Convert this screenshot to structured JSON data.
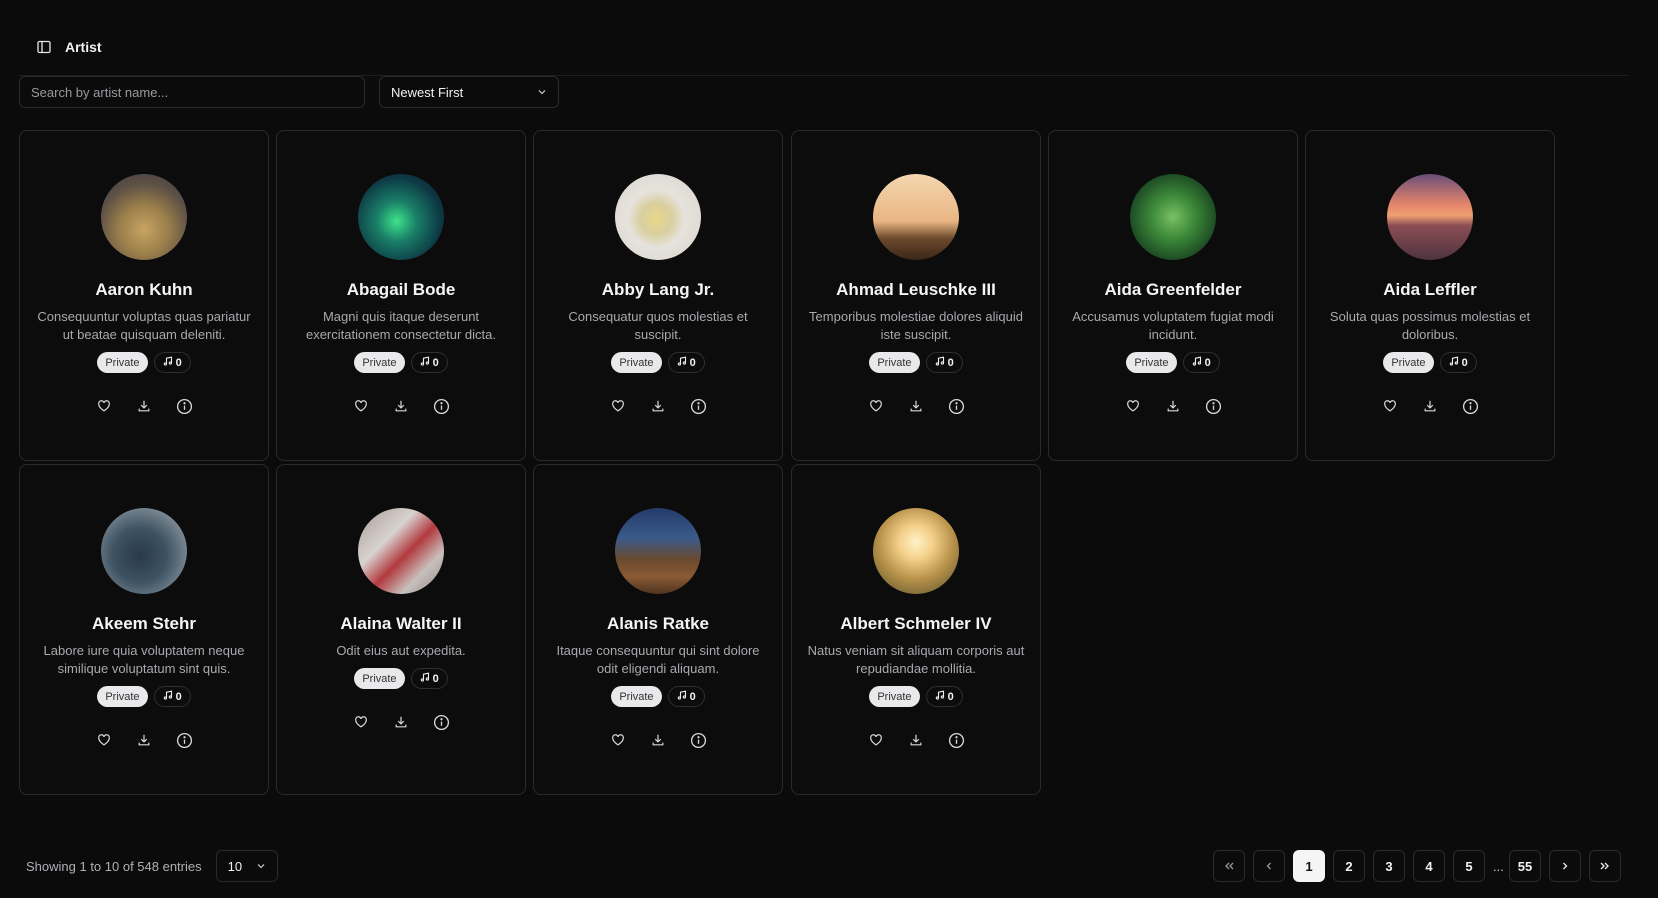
{
  "header": {
    "title": "Artist"
  },
  "search": {
    "placeholder": "Search by artist name..."
  },
  "sort": {
    "selected": "Newest First"
  },
  "artists": [
    {
      "name": "Aaron Kuhn",
      "description": "Consequuntur voluptas quas pariatur ut beatae quisquam deleniti.",
      "visibility": "Private",
      "tracks": "0",
      "avatar": "coral"
    },
    {
      "name": "Abagail Bode",
      "description": "Magni quis itaque deserunt exercitationem consectetur dicta.",
      "visibility": "Private",
      "tracks": "0",
      "avatar": "aurora"
    },
    {
      "name": "Abby Lang Jr.",
      "description": "Consequatur quos molestias et suscipit.",
      "visibility": "Private",
      "tracks": "0",
      "avatar": "tea-cup"
    },
    {
      "name": "Ahmad Leuschke III",
      "description": "Temporibus molestiae dolores aliquid iste suscipit.",
      "visibility": "Private",
      "tracks": "0",
      "avatar": "sunset-field"
    },
    {
      "name": "Aida Greenfelder",
      "description": "Accusamus voluptatem fugiat modi incidunt.",
      "visibility": "Private",
      "tracks": "0",
      "avatar": "green-plant"
    },
    {
      "name": "Aida Leffler",
      "description": "Soluta quas possimus molestias et doloribus.",
      "visibility": "Private",
      "tracks": "0",
      "avatar": "sunset-sea"
    },
    {
      "name": "Akeem Stehr",
      "description": "Labore iure quia voluptatem neque similique voluptatum sint quis.",
      "visibility": "Private",
      "tracks": "0",
      "avatar": "people-steps"
    },
    {
      "name": "Alaina Walter II",
      "description": "Odit eius aut expedita.",
      "visibility": "Private",
      "tracks": "0",
      "avatar": "red-tricycle"
    },
    {
      "name": "Alanis Ratke",
      "description": "Itaque consequuntur qui sint dolore odit eligendi aliquam.",
      "visibility": "Private",
      "tracks": "0",
      "avatar": "desert-night"
    },
    {
      "name": "Albert Schmeler IV",
      "description": "Natus veniam sit aliquam corporis aut repudiandae mollitia.",
      "visibility": "Private",
      "tracks": "0",
      "avatar": "sun-flare"
    }
  ],
  "footer": {
    "entries_text": "Showing 1 to 10 of 548 entries",
    "page_size": "10",
    "pages": [
      "1",
      "2",
      "3",
      "4",
      "5"
    ],
    "ellipsis": "...",
    "last_page": "55",
    "current_page": "1"
  },
  "colors": {
    "background": "#0b0b0c",
    "card_border": "#2a2a2d",
    "text_muted": "#a9a9ae"
  }
}
